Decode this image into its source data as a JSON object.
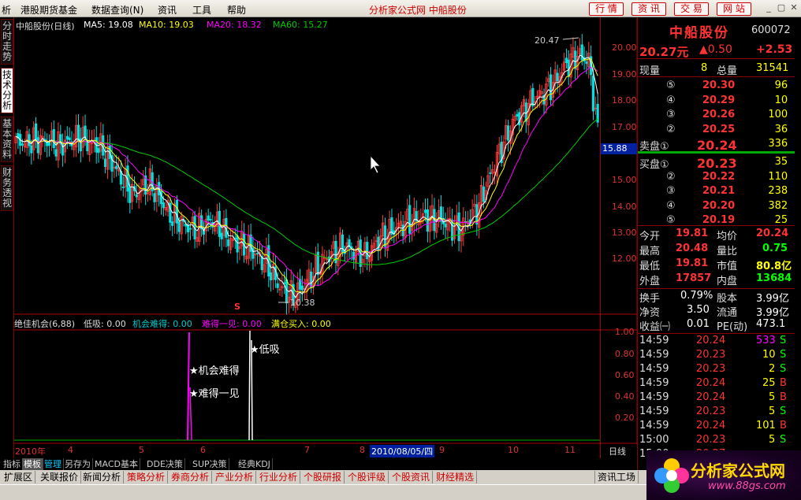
{
  "menu": {
    "items": [
      "析",
      "港股期货基金",
      "数据查询(N)",
      "资讯",
      "工具",
      "帮助"
    ],
    "center_title": "分析家公式网 中船股份",
    "right_buttons": [
      "行 情",
      "资 讯",
      "交 易",
      "网 站"
    ]
  },
  "left_tabs": [
    "分时走势",
    "技术分析",
    "基本资料",
    "财务透视"
  ],
  "chart": {
    "header": {
      "name": "中船股份(日线)",
      "ma5": "MA5: 19.08",
      "ma10": "MA10: 19.03",
      "ma20": "MA20: 18.32",
      "ma60": "MA60: 15.27"
    },
    "price_axis": [
      "20.00",
      "19.00",
      "18.00",
      "17.00",
      "16.00",
      "15.00",
      "14.00",
      "13.00",
      "12.00"
    ],
    "current_price_tag": "15.88",
    "high_label": "20.47",
    "low_label": "10.38",
    "s_marker": "S",
    "indicator_header": {
      "name": "绝佳机会(6,88)",
      "dixi": "低吸: 0.00",
      "jihui": "机会难得: 0.00",
      "nande": "难得一见: 0.00",
      "mancang": "满仓买入: 0.00"
    },
    "indicator_axis": [
      "1.00",
      "0.80",
      "0.60",
      "0.40",
      "0.20"
    ],
    "signals": [
      "★机会难得",
      "★难得一见",
      "★低吸"
    ],
    "date_axis": {
      "year": "2010年",
      "ticks": [
        "4",
        "5",
        "6",
        "7",
        "8",
        "9",
        "10",
        "11"
      ],
      "highlight": "2010/08/05/四"
    }
  },
  "chart_data": {
    "type": "candlestick",
    "title": "中船股份(日线)",
    "ylim": [
      10,
      21
    ],
    "high": 20.47,
    "low": 10.38,
    "series": [
      {
        "name": "MA5",
        "last": 19.08
      },
      {
        "name": "MA10",
        "last": 19.03
      },
      {
        "name": "MA20",
        "last": 18.32
      },
      {
        "name": "MA60",
        "last": 15.27
      }
    ]
  },
  "quote": {
    "name": "中船股份",
    "code": "600072",
    "price": "20.27元",
    "change": "▲0.50",
    "pct": "+2.53",
    "xianliang_label": "现量",
    "xianliang": "8",
    "zongliang_label": "总量",
    "zongliang": "31541",
    "sell": [
      {
        "label": "⑤",
        "price": "20.30",
        "vol": "96"
      },
      {
        "label": "④",
        "price": "20.29",
        "vol": "10"
      },
      {
        "label": "③",
        "price": "20.26",
        "vol": "100"
      },
      {
        "label": "②",
        "price": "20.25",
        "vol": "36"
      },
      {
        "label": "卖盘①",
        "price": "20.24",
        "vol": "336"
      }
    ],
    "buy": [
      {
        "label": "买盘①",
        "price": "20.23",
        "vol": "35"
      },
      {
        "label": "②",
        "price": "20.22",
        "vol": "110"
      },
      {
        "label": "③",
        "price": "20.21",
        "vol": "238"
      },
      {
        "label": "④",
        "price": "20.20",
        "vol": "382"
      },
      {
        "label": "⑤",
        "price": "20.19",
        "vol": "25"
      }
    ],
    "stats": [
      [
        "今开",
        "19.81",
        "均价",
        "20.24"
      ],
      [
        "最高",
        "20.48",
        "量比",
        "0.75"
      ],
      [
        "最低",
        "19.81",
        "市值",
        "80.8亿"
      ],
      [
        "外盘",
        "17857",
        "内盘",
        "13684"
      ]
    ],
    "fin": [
      [
        "换手",
        "0.79%",
        "股本",
        "3.99亿"
      ],
      [
        "净资",
        "3.50",
        "流通",
        "3.99亿"
      ],
      [
        "收益㈠",
        "0.01",
        "PE(动)",
        "473.1"
      ]
    ],
    "ticks": [
      {
        "time": "14:59",
        "price": "20.24",
        "vol": "533",
        "bs": "S"
      },
      {
        "time": "14:59",
        "price": "20.23",
        "vol": "10",
        "bs": "S"
      },
      {
        "time": "14:59",
        "price": "20.23",
        "vol": "2",
        "bs": "S"
      },
      {
        "time": "14:59",
        "price": "20.24",
        "vol": "25",
        "bs": "B"
      },
      {
        "time": "14:59",
        "price": "20.24",
        "vol": "5",
        "bs": "B"
      },
      {
        "time": "14:59",
        "price": "20.23",
        "vol": "5",
        "bs": "S"
      },
      {
        "time": "14:59",
        "price": "20.24",
        "vol": "101",
        "bs": "B"
      },
      {
        "time": "15:00",
        "price": "20.23",
        "vol": "5",
        "bs": "S"
      },
      {
        "time": "15:00",
        "price": "20.27",
        "vol": "",
        "bs": ""
      }
    ]
  },
  "bottom_tabs1": [
    "指标",
    "模板",
    "管理",
    "另存为",
    "MACD基本",
    "DDE决策",
    "SUP决策",
    "经典KDJ"
  ],
  "period_label": "日线",
  "bottom_tabs2": [
    "扩展区",
    "关联报价",
    "新闻分析",
    "策略分析",
    "券商分析",
    "产业分析",
    "行业分析",
    "个股研报",
    "个股评级",
    "个股资讯",
    "财经精选"
  ],
  "zixun_label": "资讯工场",
  "logo_text": "分析家公式网",
  "logo_url": "www.88gs.com",
  "colors": {
    "up": "#ff3c3c",
    "down": "#00e0e0",
    "ma5": "#ffffff",
    "ma10": "#ffff00",
    "ma20": "#ff00ff",
    "ma60": "#00cc00"
  }
}
